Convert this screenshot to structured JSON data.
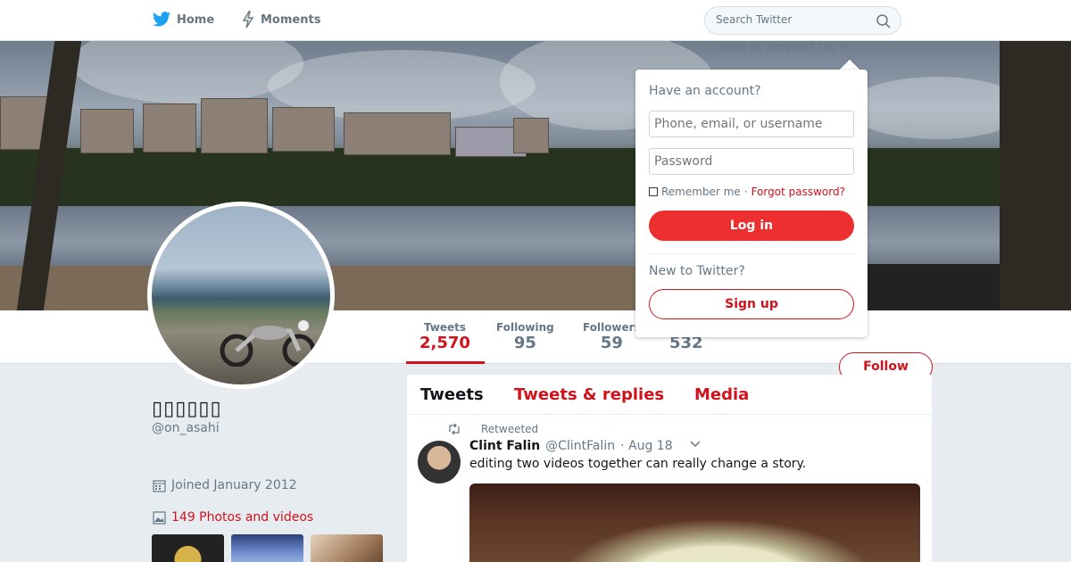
{
  "nav": {
    "home_label": "Home",
    "moments_label": "Moments",
    "search_placeholder": "Search Twitter",
    "have_account_hint": "Have an account? Log in"
  },
  "profile": {
    "display_name": "▯▯▯▯▯▯",
    "handle": "@on_asahi",
    "joined": "Joined January 2012",
    "photos_label": "149 Photos and videos",
    "follow_label": "Follow"
  },
  "stats": [
    {
      "label": "Tweets",
      "value": "2,570"
    },
    {
      "label": "Following",
      "value": "95"
    },
    {
      "label": "Followers",
      "value": "59"
    },
    {
      "label": "",
      "value": "532"
    }
  ],
  "timeline": {
    "tabs": [
      "Tweets",
      "Tweets & replies",
      "Media"
    ],
    "retweet_label": "Retweeted",
    "tweet": {
      "name": "Clint Falin",
      "handle": "@ClintFalin",
      "date": "· Aug 18",
      "text": "editing two videos together can really change a story."
    }
  },
  "login": {
    "title": "Have an account?",
    "username_placeholder": "Phone, email, or username",
    "password_placeholder": "Password",
    "remember": "Remember me",
    "separator": "·",
    "forgot": "Forgot password?",
    "login_label": "Log in",
    "new_label": "New to Twitter?",
    "signup_label": "Sign up"
  },
  "colors": {
    "accent": "#d0121d",
    "login_button": "#ee2f30",
    "brand_bird": "#1da1f2"
  }
}
